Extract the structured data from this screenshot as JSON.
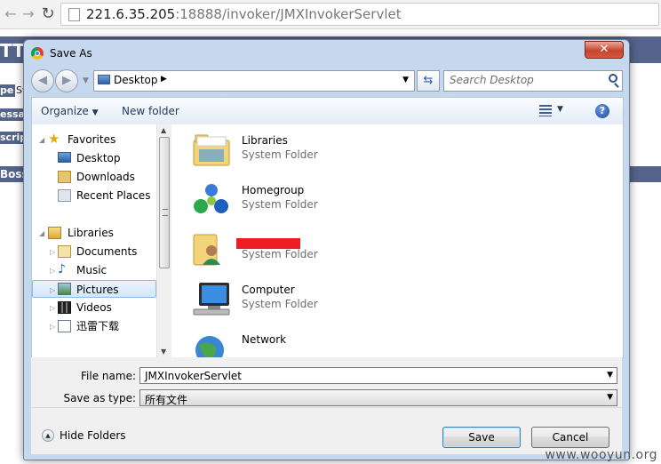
{
  "browser": {
    "url_host": "221.6.35.205",
    "url_rest": ":18888/invoker/JMXInvokerServlet"
  },
  "background_page": {
    "title_prefix": "TT",
    "labels": [
      "pe",
      "essag",
      "scrip"
    ],
    "label_texts": [
      "St",
      "",
      ""
    ],
    "footer_text": "Boss"
  },
  "dialog": {
    "title": "Save As",
    "close_label": "✕",
    "address": {
      "location": "Desktop"
    },
    "search": {
      "placeholder": "Search Desktop"
    },
    "toolbar": {
      "organize_label": "Organize",
      "new_folder_label": "New folder"
    },
    "nav": {
      "items": [
        {
          "label": "Favorites",
          "icon": "star-icon",
          "level": 0
        },
        {
          "label": "Desktop",
          "icon": "desktop-icon",
          "level": 1
        },
        {
          "label": "Downloads",
          "icon": "downloads-icon",
          "level": 1
        },
        {
          "label": "Recent Places",
          "icon": "recent-places-icon",
          "level": 1
        },
        {
          "label": "Libraries",
          "icon": "libraries-icon",
          "level": 0
        },
        {
          "label": "Documents",
          "icon": "documents-icon",
          "level": 1
        },
        {
          "label": "Music",
          "icon": "music-icon",
          "level": 1
        },
        {
          "label": "Pictures",
          "icon": "pictures-icon",
          "level": 1,
          "selected": true
        },
        {
          "label": "Videos",
          "icon": "videos-icon",
          "level": 1
        },
        {
          "label": "迅雷下载",
          "icon": "thunder-downloads-icon",
          "level": 1
        }
      ]
    },
    "files": [
      {
        "name": "Libraries",
        "type": "System Folder",
        "icon": "libraries-folder-icon"
      },
      {
        "name": "Homegroup",
        "type": "System Folder",
        "icon": "homegroup-icon"
      },
      {
        "name": "",
        "type": "System Folder",
        "icon": "user-folder-icon",
        "redacted": true
      },
      {
        "name": "Computer",
        "type": "System Folder",
        "icon": "computer-icon"
      },
      {
        "name": "Network",
        "type": "",
        "icon": "network-icon"
      }
    ],
    "file_name_label": "File name:",
    "file_name_value": "JMXInvokerServlet",
    "save_type_label": "Save as type:",
    "save_type_value": "所有文件",
    "hide_folders_label": "Hide Folders",
    "save_label": "Save",
    "cancel_label": "Cancel",
    "redaction_color": "#ee1c25"
  },
  "watermark": "www.wooyun.org"
}
